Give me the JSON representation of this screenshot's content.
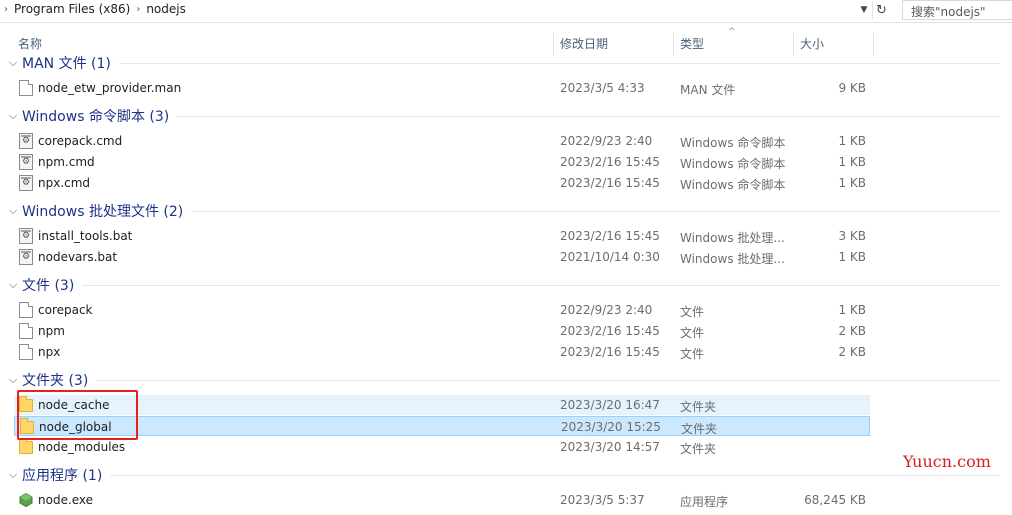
{
  "address": {
    "crumbs": [
      "Program Files (x86)",
      "nodejs"
    ],
    "search_placeholder": "搜索\"nodejs\""
  },
  "columns": {
    "name": "名称",
    "date": "修改日期",
    "type": "类型",
    "size": "大小"
  },
  "groups": [
    {
      "label": "MAN 文件 (1)",
      "items": [
        {
          "name": "node_etw_provider.man",
          "date": "2023/3/5 4:33",
          "type": "MAN 文件",
          "size": "9 KB",
          "icon": "file-icon"
        }
      ]
    },
    {
      "label": "Windows 命令脚本 (3)",
      "items": [
        {
          "name": "corepack.cmd",
          "date": "2022/9/23 2:40",
          "type": "Windows 命令脚本",
          "size": "1 KB",
          "icon": "script-icon"
        },
        {
          "name": "npm.cmd",
          "date": "2023/2/16 15:45",
          "type": "Windows 命令脚本",
          "size": "1 KB",
          "icon": "script-icon"
        },
        {
          "name": "npx.cmd",
          "date": "2023/2/16 15:45",
          "type": "Windows 命令脚本",
          "size": "1 KB",
          "icon": "script-icon"
        }
      ]
    },
    {
      "label": "Windows 批处理文件 (2)",
      "items": [
        {
          "name": "install_tools.bat",
          "date": "2023/2/16 15:45",
          "type": "Windows 批处理...",
          "size": "3 KB",
          "icon": "script-icon"
        },
        {
          "name": "nodevars.bat",
          "date": "2021/10/14 0:30",
          "type": "Windows 批处理...",
          "size": "1 KB",
          "icon": "script-icon"
        }
      ]
    },
    {
      "label": "文件 (3)",
      "items": [
        {
          "name": "corepack",
          "date": "2022/9/23 2:40",
          "type": "文件",
          "size": "1 KB",
          "icon": "file-icon"
        },
        {
          "name": "npm",
          "date": "2023/2/16 15:45",
          "type": "文件",
          "size": "2 KB",
          "icon": "file-icon"
        },
        {
          "name": "npx",
          "date": "2023/2/16 15:45",
          "type": "文件",
          "size": "2 KB",
          "icon": "file-icon"
        }
      ]
    },
    {
      "label": "文件夹 (3)",
      "items": [
        {
          "name": "node_cache",
          "date": "2023/3/20 16:47",
          "type": "文件夹",
          "size": "",
          "icon": "folder-icon"
        },
        {
          "name": "node_global",
          "date": "2023/3/20 15:25",
          "type": "文件夹",
          "size": "",
          "icon": "folder-icon"
        },
        {
          "name": "node_modules",
          "date": "2023/3/20 14:57",
          "type": "文件夹",
          "size": "",
          "icon": "folder-icon"
        }
      ]
    },
    {
      "label": "应用程序 (1)",
      "items": [
        {
          "name": "node.exe",
          "date": "2023/3/5 5:37",
          "type": "应用程序",
          "size": "68,245 KB",
          "icon": "node-exe-icon"
        }
      ]
    }
  ],
  "watermark": "Yuucn.com",
  "colors": {
    "selection": "#cce8ff",
    "hover": "#e5f3ff",
    "group_text": "#1e3287",
    "annotation": "#e8211b",
    "watermark": "#d41f1f"
  }
}
